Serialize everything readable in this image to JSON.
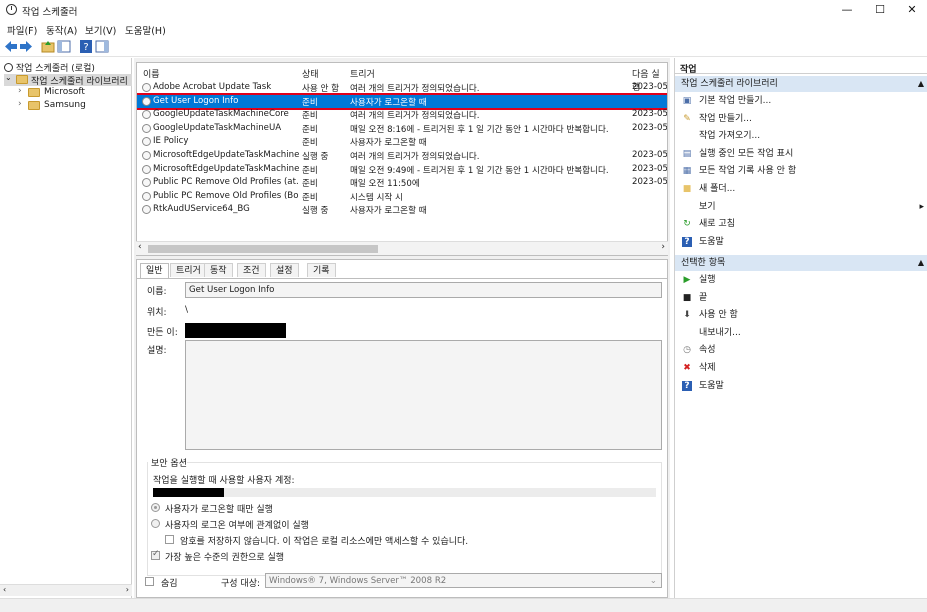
{
  "window": {
    "title": "작업 스케줄러",
    "minimize": "—",
    "maximize": "☐",
    "close": "✕"
  },
  "menu": [
    "파일(F)",
    "동작(A)",
    "보기(V)",
    "도움말(H)"
  ],
  "tree": {
    "root": "작업 스케줄러 (로컬)",
    "library": "작업 스케줄러 라이브러리",
    "children": [
      "Microsoft",
      "Samsung"
    ]
  },
  "tasklist": {
    "columns": [
      "이름",
      "상태",
      "트리거",
      "다음 실행"
    ],
    "rows": [
      {
        "name": "Adobe Acrobat Update Task",
        "status": "사용 안 함",
        "trigger": "여러 개의 트리거가 정의되었습니다.",
        "next": "2023-05-"
      },
      {
        "name": "Get User Logon Info",
        "status": "준비",
        "trigger": "사용자가 로그온할 때",
        "next": ""
      },
      {
        "name": "GoogleUpdateTaskMachineCore",
        "status": "준비",
        "trigger": "여러 개의 트리거가 정의되었습니다.",
        "next": "2023-05-"
      },
      {
        "name": "GoogleUpdateTaskMachineUA",
        "status": "준비",
        "trigger": "매일 오전 8:16에 - 트리거된 후 1 일 기간 동안 1 시간마다 반복합니다.",
        "next": "2023-05-"
      },
      {
        "name": "IE Policy",
        "status": "준비",
        "trigger": "사용자가 로그온할 때",
        "next": ""
      },
      {
        "name": "MicrosoftEdgeUpdateTaskMachineC...",
        "status": "실행 중",
        "trigger": "여러 개의 트리거가 정의되었습니다.",
        "next": "2023-05-"
      },
      {
        "name": "MicrosoftEdgeUpdateTaskMachineUA",
        "status": "준비",
        "trigger": "매일 오전 9:49에 - 트리거된 후 1 일 기간 동안 1 시간마다 반복합니다.",
        "next": "2023-05-"
      },
      {
        "name": "Public PC Remove Old Profiles (at...",
        "status": "준비",
        "trigger": "매일 오전 11:50에",
        "next": "2023-05-"
      },
      {
        "name": "Public PC Remove Old Profiles (Bo...",
        "status": "준비",
        "trigger": "시스템 시작 시",
        "next": ""
      },
      {
        "name": "RtkAudUService64_BG",
        "status": "실행 중",
        "trigger": "사용자가 로그온할 때",
        "next": ""
      }
    ],
    "selected_index": 1
  },
  "detail": {
    "tabs": [
      "일반",
      "트리거",
      "동작",
      "조건",
      "설정",
      "기록"
    ],
    "name_label": "이름:",
    "name_value": "Get User Logon Info",
    "location_label": "위치:",
    "location_value": "\\",
    "author_label": "만든 이:",
    "description_label": "설명:",
    "security_title": "보안 옵션",
    "account_label": "작업을 실행할 때 사용할 사용자 계정:",
    "radio_logged_on": "사용자가 로그온할 때만 실행",
    "radio_whether": "사용자의 로그온 여부에 관계없이 실행",
    "no_store_password": "암호를 저장하지 않습니다. 이 작업은 로컬 리소스에만 액세스할 수 있습니다.",
    "highest_privileges": "가장 높은 수준의 권한으로 실행",
    "hidden_label": "숨김",
    "configure_label": "구성 대상:",
    "configure_value": "Windows® 7, Windows Server™ 2008 R2"
  },
  "actions": {
    "header": "작업",
    "section1_title": "작업 스케줄러 라이브러리",
    "section1": [
      {
        "label": "기본 작업 만들기...",
        "icon": "basic-task-icon"
      },
      {
        "label": "작업 만들기...",
        "icon": "create-task-icon"
      },
      {
        "label": "작업 가져오기...",
        "icon": ""
      },
      {
        "label": "실행 중인 모든 작업 표시",
        "icon": "running-tasks-icon"
      },
      {
        "label": "모든 작업 기록 사용 안 함",
        "icon": "history-icon"
      },
      {
        "label": "새 폴더...",
        "icon": "folder-icon"
      },
      {
        "label": "보기",
        "icon": ""
      },
      {
        "label": "새로 고침",
        "icon": "refresh-icon"
      },
      {
        "label": "도움말",
        "icon": "help-icon"
      }
    ],
    "section2_title": "선택한 항목",
    "section2": [
      {
        "label": "실행",
        "icon": "run-icon"
      },
      {
        "label": "끝",
        "icon": "stop-icon"
      },
      {
        "label": "사용 안 함",
        "icon": "disable-icon"
      },
      {
        "label": "내보내기...",
        "icon": ""
      },
      {
        "label": "속성",
        "icon": "properties-icon"
      },
      {
        "label": "삭제",
        "icon": "delete-icon"
      },
      {
        "label": "도움말",
        "icon": "help-icon"
      }
    ]
  },
  "colors": {
    "selection": "#0078d7",
    "highlight_border": "#e0001a",
    "section_header": "#d9e6f4",
    "delete": "#d32020",
    "run": "#2a9d2a",
    "help": "#2b5fb3"
  }
}
